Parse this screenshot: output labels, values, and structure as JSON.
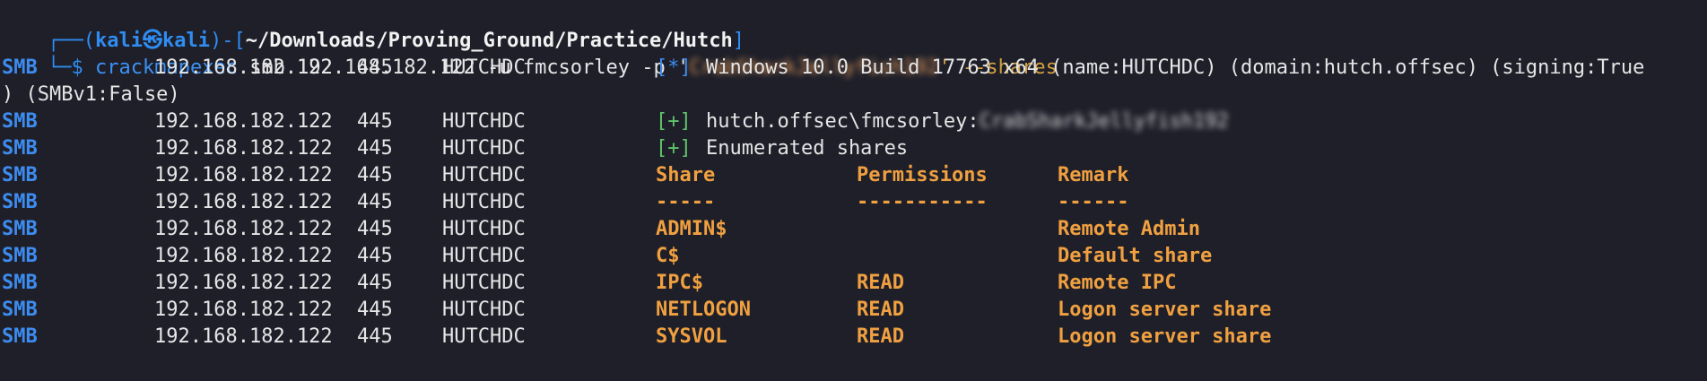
{
  "prompt": {
    "frame_top_left": "┌──(",
    "user": "kali",
    "at_symbol": "㉿",
    "host": "kali",
    "frame_mid": ")-[",
    "path": "~/Downloads/Proving_Ground/Practice/Hutch",
    "frame_close": "]",
    "frame_bottom": "└─$",
    "command": "crackmapexec",
    "args_1": "smb 192.168.182.122 -u fmcsorley -p '",
    "password_redacted": "CrabSharkJellyfish192",
    "args_2": "' --shares"
  },
  "colors": {
    "background": "#1e1f29",
    "smb_blue": "#3d8cf0",
    "header_orange": "#f0a040",
    "plus_green": "#5fc46a"
  },
  "output": {
    "proto": "SMB",
    "ip": "192.168.182.122",
    "port": "445",
    "host": "HUTCHDC",
    "info_tag": "[*]",
    "info_text": "Windows 10.0 Build 17763 x64 (name:HUTCHDC) (domain:hutch.offsec) (signing:True",
    "info_wrap": ") (SMBv1:False)",
    "auth_tag": "[+]",
    "auth_text": "hutch.offsec\\fmcsorley:",
    "auth_password_redacted": "CrabSharkJellyfish192",
    "enum_tag": "[+]",
    "enum_text": "Enumerated shares",
    "headers": {
      "share": "Share",
      "permissions": "Permissions",
      "remark": "Remark"
    },
    "underlines": {
      "share": "-----",
      "permissions": "-----------",
      "remark": "------"
    },
    "shares": [
      {
        "name": "ADMIN$",
        "permissions": "",
        "remark": "Remote Admin"
      },
      {
        "name": "C$",
        "permissions": "",
        "remark": "Default share"
      },
      {
        "name": "IPC$",
        "permissions": "READ",
        "remark": "Remote IPC"
      },
      {
        "name": "NETLOGON",
        "permissions": "READ",
        "remark": "Logon server share"
      },
      {
        "name": "SYSVOL",
        "permissions": "READ",
        "remark": "Logon server share"
      }
    ]
  }
}
